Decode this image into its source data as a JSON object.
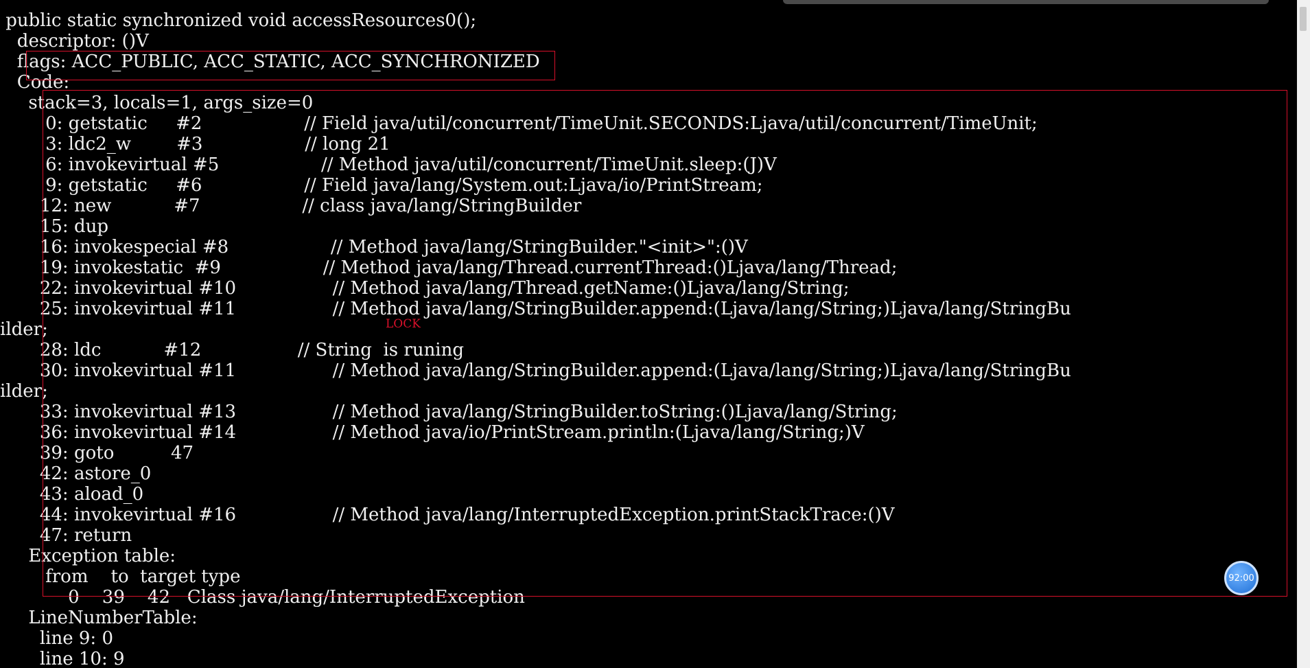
{
  "terminal": {
    "lines": [
      " public static synchronized void accessResources0();",
      "   descriptor: ()V",
      "   flags: ACC_PUBLIC, ACC_STATIC, ACC_SYNCHRONIZED",
      "   Code:",
      "     stack=3, locals=1, args_size=0",
      "        0: getstatic     #2                  // Field java/util/concurrent/TimeUnit.SECONDS:Ljava/util/concurrent/TimeUnit;",
      "        3: ldc2_w        #3                  // long 21",
      "        6: invokevirtual #5                  // Method java/util/concurrent/TimeUnit.sleep:(J)V",
      "        9: getstatic     #6                  // Field java/lang/System.out:Ljava/io/PrintStream;",
      "       12: new           #7                  // class java/lang/StringBuilder",
      "       15: dup",
      "       16: invokespecial #8                  // Method java/lang/StringBuilder.\"<init>\":()V",
      "       19: invokestatic  #9                  // Method java/lang/Thread.currentThread:()Ljava/lang/Thread;",
      "       22: invokevirtual #10                 // Method java/lang/Thread.getName:()Ljava/lang/String;",
      "       25: invokevirtual #11                 // Method java/lang/StringBuilder.append:(Ljava/lang/String;)Ljava/lang/StringBu",
      "ilder;",
      "       28: ldc           #12                 // String  is runing",
      "       30: invokevirtual #11                 // Method java/lang/StringBuilder.append:(Ljava/lang/String;)Ljava/lang/StringBu",
      "ilder;",
      "       33: invokevirtual #13                 // Method java/lang/StringBuilder.toString:()Ljava/lang/String;",
      "       36: invokevirtual #14                 // Method java/io/PrintStream.println:(Ljava/lang/String;)V",
      "       39: goto          47",
      "       42: astore_0",
      "       43: aload_0",
      "       44: invokevirtual #16                 // Method java/lang/InterruptedException.printStackTrace:()V",
      "       47: return",
      "     Exception table:",
      "        from    to  target type",
      "            0    39    42   Class java/lang/InterruptedException",
      "     LineNumberTable:",
      "       line 9: 0",
      "       line 10: 9"
    ]
  },
  "annotations": {
    "lock_label": "LOCK",
    "highlight_color": "#d8102a"
  },
  "clock_badge": {
    "text": "92:00"
  }
}
